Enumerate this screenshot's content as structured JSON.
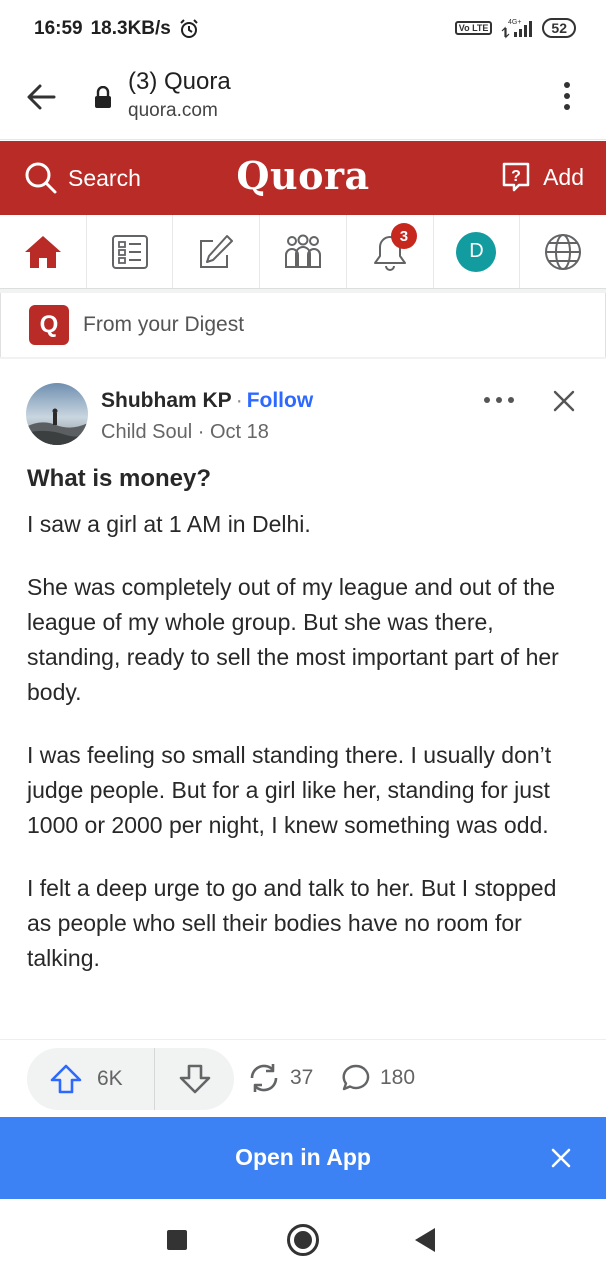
{
  "status_bar": {
    "time": "16:59",
    "speed": "18.3KB/s",
    "network": "4G+",
    "volte": "Vo LTE",
    "battery": "52"
  },
  "browser": {
    "title": "(3) Quora",
    "host": "quora.com"
  },
  "header": {
    "search_label": "Search",
    "logo": "Quora",
    "add_label": "Add",
    "brand_color": "#b92b27"
  },
  "nav": {
    "items": [
      {
        "name": "home",
        "icon": "home-icon"
      },
      {
        "name": "following",
        "icon": "list-icon"
      },
      {
        "name": "answer",
        "icon": "pencil-square-icon"
      },
      {
        "name": "spaces",
        "icon": "people-icon"
      },
      {
        "name": "notifications",
        "icon": "bell-icon"
      },
      {
        "name": "profile",
        "icon": "avatar"
      },
      {
        "name": "languages",
        "icon": "globe-icon"
      }
    ],
    "notification_count": "3",
    "profile_initial": "D"
  },
  "digest": {
    "logo_letter": "Q",
    "label": "From your Digest"
  },
  "post": {
    "author": "Shubham KP",
    "separator": "·",
    "follow_label": "Follow",
    "credential": "Child Soul",
    "date": "Oct 18",
    "title": "What is money?",
    "paragraphs": [
      "I saw a girl at 1 AM in Delhi.",
      "She was completely out of my league and out of the league of my whole group. But she was there, standing, ready to sell the most important part of her body.",
      "I was feeling so small standing there. I usually don’t judge people. But for a girl like her, standing for just 1000 or 2000 per night, I knew something was odd.",
      "I felt a deep urge to go and talk to her. But I stopped as people who sell their bodies have no room for talking."
    ]
  },
  "actions": {
    "upvotes": "6K",
    "shares": "37",
    "comments": "180"
  },
  "open_app": {
    "label": "Open in App",
    "color": "#3d82f5"
  }
}
